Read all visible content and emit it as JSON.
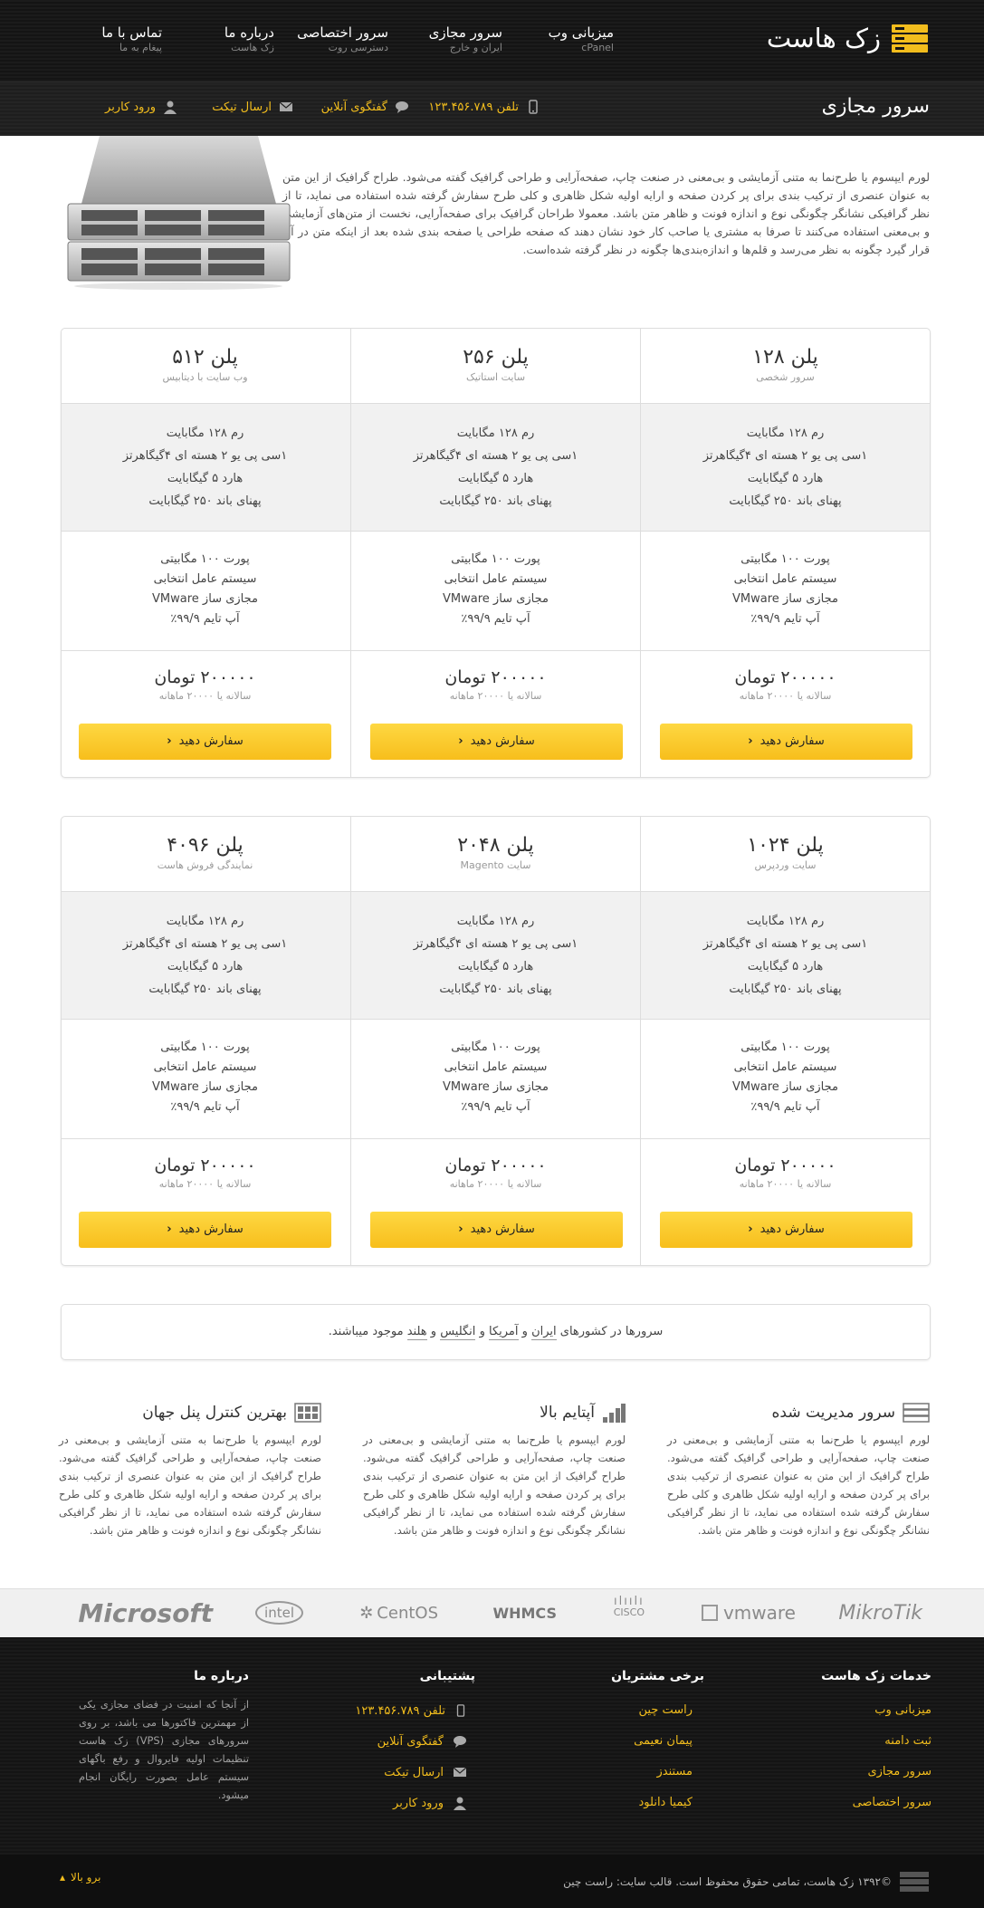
{
  "header": {
    "logo_text": "زک هاست",
    "nav": [
      {
        "title": "میزبانی وب",
        "sub": "cPanel"
      },
      {
        "title": "سرور مجازی",
        "sub": "ایران و خارج"
      },
      {
        "title": "سرور اختصاصی",
        "sub": "دسترسی روت"
      },
      {
        "title": "درباره ما",
        "sub": "زک هاست"
      },
      {
        "title": "تماس با ما",
        "sub": "پیغام به ما"
      }
    ],
    "page_title": "سرور مجازی",
    "links": {
      "phone": "تلفن ۱۲۳.۴۵۶.۷۸۹",
      "chat": "گفتگوی آنلاین",
      "ticket": "ارسال تیکت",
      "login": "ورود کاربر"
    }
  },
  "intro": "لورم ایپسوم یا طرح‌نما به متنی آزمایشی و بی‌معنی در صنعت چاپ، صفحه‌آرایی و طراحی گرافیک گفته می‌شود. طراح گرافیک از این متن به عنوان عنصری از ترکیب بندی برای پر کردن صفحه و ارایه اولیه شکل ظاهری و کلی طرح سفارش گرفته شده استفاده می نماید، تا از نظر گرافیکی نشانگر چگونگی نوع و اندازه فونت و ظاهر متن باشد. معمولا طراحان گرافیک برای صفحه‌آرایی، نخست از متن‌های آزمایشی و بی‌معنی استفاده می‌کنند تا صرفا به مشتری یا صاحب کار خود نشان دهند که صفحه طراحی یا صفحه بندی شده بعد از اینکه متن در آن قرار گیرد چگونه به نظر می‌رسد و قلم‌ها و اندازه‌بندی‌ها چگونه در نظر گرفته شده‌است.",
  "plan_common": {
    "f1": [
      "رم ۱۲۸ مگابایت",
      "۱سی پی یو ۲ هسته ای ۴گیگاهرتز",
      "هارد ۵ گیگابایت",
      "پهنای باند ۲۵۰ گیگابایت"
    ],
    "f2": [
      "پورت ۱۰۰ مگابیتی",
      "سیستم عامل انتخابی",
      "مجازی ساز VMware",
      "آپ تایم ۹۹/۹٪"
    ],
    "price": "۲۰۰۰۰۰ تومان",
    "yearly": "سالانه یا ۲۰۰۰۰ ماهانه",
    "order": "سفارش دهید"
  },
  "plans_row1": [
    {
      "name": "پلن ۱۲۸",
      "desc": "سرور شخصی"
    },
    {
      "name": "پلن ۲۵۶",
      "desc": "سایت استاتیک"
    },
    {
      "name": "پلن ۵۱۲",
      "desc": "وب سایت با دیتابیس"
    }
  ],
  "plans_row2": [
    {
      "name": "پلن ۱۰۲۴",
      "desc": "سایت وردپرس"
    },
    {
      "name": "پلن ۲۰۴۸",
      "desc": "سایت Magento"
    },
    {
      "name": "پلن ۴۰۹۶",
      "desc": "نمایندگی فروش هاست"
    }
  ],
  "countries": {
    "prefix": "سرورها در کشورهای",
    "c1": "ایران",
    "c2": "آمریکا",
    "c3": "انگلیس",
    "c4": "هلند",
    "and": "و",
    "suffix": "موجود میباشند."
  },
  "features": [
    {
      "title": "سرور مدیریت شده",
      "text": "لورم ایپسوم یا طرح‌نما به متنی آزمایشی و بی‌معنی در صنعت چاپ، صفحه‌آرایی و طراحی گرافیک گفته می‌شود. طراح گرافیک از این متن به عنوان عنصری از ترکیب بندی برای پر کردن صفحه و ارایه اولیه شکل ظاهری و کلی طرح سفارش گرفته شده استفاده می نماید، تا از نظر گرافیکی نشانگر چگونگی نوع و اندازه فونت و ظاهر متن باشد."
    },
    {
      "title": "آپتایم بالا",
      "text": "لورم ایپسوم یا طرح‌نما به متنی آزمایشی و بی‌معنی در صنعت چاپ، صفحه‌آرایی و طراحی گرافیک گفته می‌شود. طراح گرافیک از این متن به عنوان عنصری از ترکیب بندی برای پر کردن صفحه و ارایه اولیه شکل ظاهری و کلی طرح سفارش گرفته شده استفاده می نماید، تا از نظر گرافیکی نشانگر چگونگی نوع و اندازه فونت و ظاهر متن باشد."
    },
    {
      "title": "بهترین کنترل پنل جهان",
      "text": "لورم ایپسوم یا طرح‌نما به متنی آزمایشی و بی‌معنی در صنعت چاپ، صفحه‌آرایی و طراحی گرافیک گفته می‌شود. طراح گرافیک از این متن به عنوان عنصری از ترکیب بندی برای پر کردن صفحه و ارایه اولیه شکل ظاهری و کلی طرح سفارش گرفته شده استفاده می نماید، تا از نظر گرافیکی نشانگر چگونگی نوع و اندازه فونت و ظاهر متن باشد."
    }
  ],
  "logos": [
    "MikroTik",
    "vmware",
    "CISCO",
    "WHMCS",
    "CentOS",
    "intel",
    "Microsoft"
  ],
  "footer": {
    "services_title": "خدمات زک هاست",
    "services": [
      "میزبانی وب",
      "ثبت دامنه",
      "سرور مجازی",
      "سرور اختصاصی"
    ],
    "customers_title": "برخی مشتریان",
    "customers": [
      "راست چین",
      "پیمان نعیمی",
      "مستندز",
      "کیمیا دانلود"
    ],
    "support_title": "پشتیبانی",
    "support": [
      "تلفن ۱۲۳.۴۵۶.۷۸۹",
      "گفتگوی آنلاین",
      "ارسال تیکت",
      "ورود کاربر"
    ],
    "about_title": "درباره ما",
    "about_text": "از آنجا که امنیت در فضای مجازی یکی از مهمترین فاکتورها می باشد، بر روی سرورهای مجازی (VPS) زک هاست تنظیمات اولیه فایروال و رفع باگهای سیستم عامل بصورت رایگان انجام میشود.",
    "copyright": "©۱۳۹۲ زک هاست، تمامی حقوق محفوظ است. قالب سایت: راست چین",
    "to_top": "برو بالا"
  }
}
